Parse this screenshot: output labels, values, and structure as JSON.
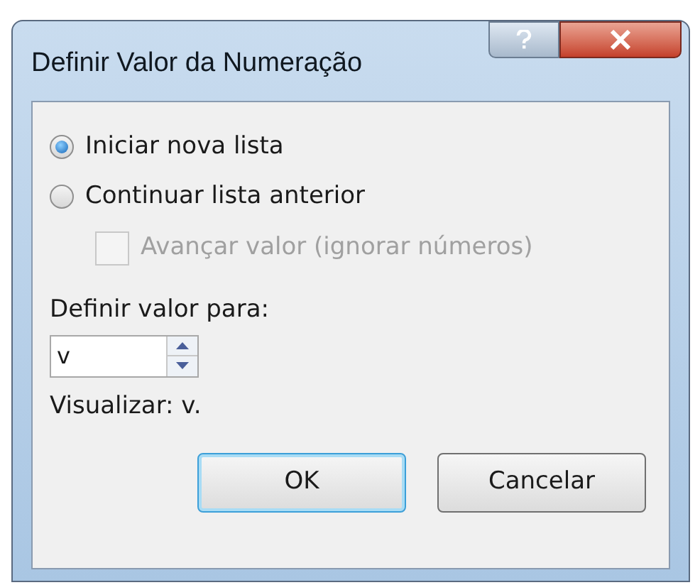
{
  "window": {
    "title": "Definir Valor da Numeração"
  },
  "options": [
    {
      "kind": "radio",
      "label": "Iniciar nova lista",
      "selected": true,
      "disabled": false
    },
    {
      "kind": "radio",
      "label": "Continuar lista anterior",
      "selected": false,
      "disabled": false
    },
    {
      "kind": "checkbox",
      "label": "Avançar valor (ignorar números)",
      "checked": false,
      "disabled": true
    }
  ],
  "value_field": {
    "label": "Definir valor para:",
    "value": "v"
  },
  "preview": "Visualizar: v.",
  "buttons": [
    {
      "label": "OK",
      "default": true
    },
    {
      "label": "Cancelar",
      "default": false
    }
  ]
}
